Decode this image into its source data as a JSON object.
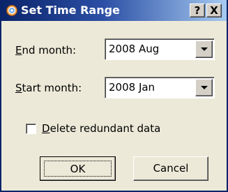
{
  "dialog": {
    "title": "Set Time Range",
    "help_label": "?",
    "close_label": "X"
  },
  "end_month": {
    "label_mnemonic": "E",
    "label_rest": "nd month:",
    "value": "2008 Aug"
  },
  "start_month": {
    "label_mnemonic": "S",
    "label_rest": "tart month:",
    "value": "2008 Jan"
  },
  "delete_redundant": {
    "label_mnemonic": "D",
    "label_rest": "elete redundant data",
    "checked": false
  },
  "buttons": {
    "ok": "OK",
    "cancel": "Cancel"
  },
  "icons": {
    "app": "app-icon",
    "dropdown": "chevron-down-icon"
  }
}
